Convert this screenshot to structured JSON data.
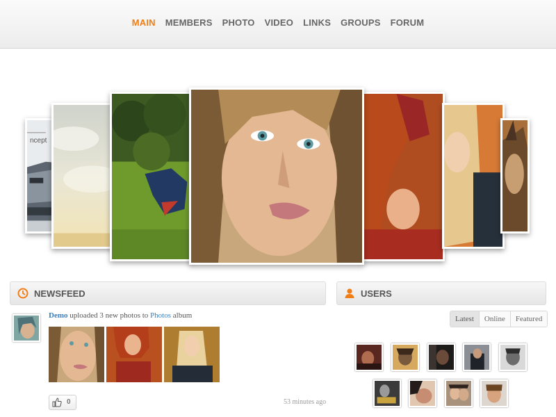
{
  "nav": {
    "items": [
      "MAIN",
      "MEMBERS",
      "PHOTO",
      "VIDEO",
      "LINKS",
      "GROUPS",
      "FORUM"
    ],
    "active": "MAIN"
  },
  "slider": {
    "caption": "ncept"
  },
  "newsfeed": {
    "title": "NEWSFEED",
    "icon": "clock-icon",
    "post": {
      "user": "Demo",
      "action": " uploaded 3 new photos to ",
      "album": "Photos",
      "suffix": " album",
      "likes": "0",
      "time": "53 minutes ago"
    }
  },
  "users": {
    "title": "USERS",
    "icon": "user-icon",
    "tabs": [
      "Latest",
      "Online",
      "Featured"
    ],
    "active_tab": "Latest"
  },
  "colors": {
    "accent": "#f07d16",
    "link": "#3a7fc1"
  }
}
